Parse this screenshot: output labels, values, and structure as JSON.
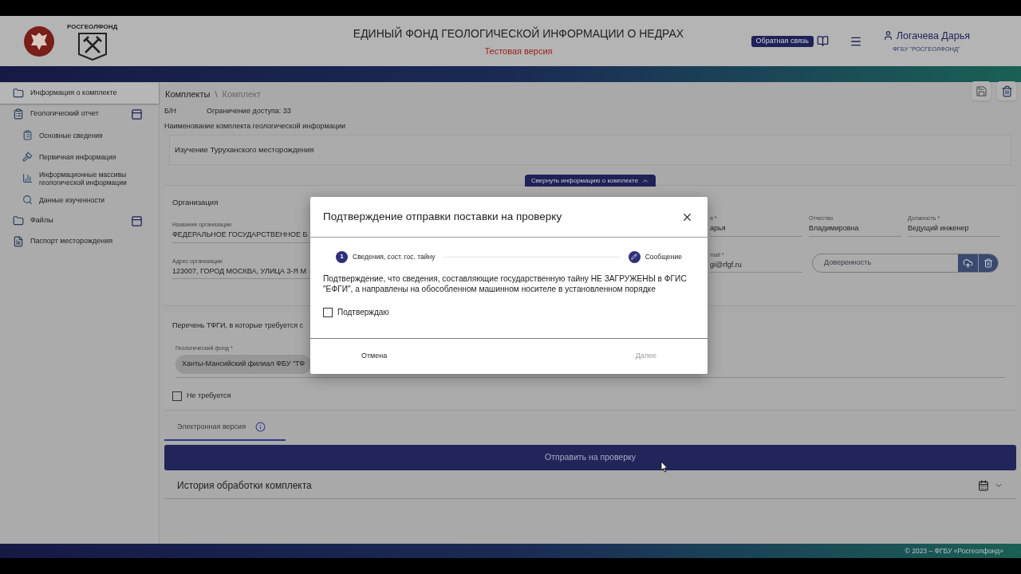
{
  "header": {
    "logo_caption": "РОСГЕОЛФОНД",
    "title": "ЕДИНЫЙ ФОНД ГЕОЛОГИЧЕСКОЙ ИНФОРМАЦИИ О НЕДРАХ",
    "subtitle": "Тестовая версия",
    "feedback_button": "Обратная связь",
    "user_name": "Логачева Дарья",
    "user_org": "ФГБУ \"РОСГЕОЛФОНД\""
  },
  "sidebar": {
    "items": [
      {
        "label": "Информация о комплекте",
        "selected": true
      },
      {
        "label": "Геологический отчет",
        "selected": false,
        "children": [
          {
            "label": "Основные сведения"
          },
          {
            "label": "Первичная информация"
          },
          {
            "label": "Информационные массивы геологической информации"
          },
          {
            "label": "Данные изученности"
          }
        ]
      },
      {
        "label": "Файлы",
        "selected": false
      },
      {
        "label": "Паспорт месторождения",
        "selected": false
      }
    ]
  },
  "breadcrumbs": [
    {
      "label": "Комплекты",
      "current": false
    },
    {
      "label": "Комплект",
      "current": true
    }
  ],
  "breadcrumb_separator": "\\",
  "set_info": {
    "number": "Б/Н",
    "access": "Ограничение доступа: 33",
    "name_label": "Наименование комплекта геологической информации",
    "name_value": "Изучение Туруханского месторождения",
    "collapse_button": "Свернуть информацию о комплекте"
  },
  "organization": {
    "title": "Организация",
    "left_fields": [
      {
        "label": "Название организации",
        "value": "ФЕДЕРАЛЬНОЕ ГОСУДАРСТВЕННОЕ Б"
      },
      {
        "label": "Адрес организации",
        "value": "123007, ГОРОД МОСКВА, УЛИЦА 3-Я М"
      }
    ],
    "right_rows": [
      [
        {
          "kind": "text",
          "label": "я *",
          "value": "арья"
        },
        {
          "kind": "text",
          "label": "Отчество",
          "value": "Владимировна"
        },
        {
          "kind": "text",
          "label": "Должность *",
          "value": "Ведущий инженер"
        }
      ],
      [
        {
          "kind": "text",
          "label": "mail *",
          "value": "gi@rfgf.ru"
        },
        {
          "kind": "file",
          "placeholder": "Доверенность"
        }
      ]
    ]
  },
  "tfgi": {
    "title": "Перечень ТФГИ, в которые требуется с",
    "fund_label": "Геологический фонд *",
    "fund_chip": "Ханты-Мансийский филиал ФБУ \"ТФ",
    "not_required": {
      "label": "Не требуется",
      "checked": false
    }
  },
  "tabs": [
    {
      "label": "Электронная версия",
      "selected": true
    }
  ],
  "submit_button": "Отправить на проверку",
  "history": {
    "title": "История обработки комплекта",
    "expanded": false
  },
  "footer": "© 2023 – ФГБУ «Росгеолфонд»",
  "dialog": {
    "title": "Подтверждение отправки поставки на проверку",
    "steps": [
      {
        "kind": "number",
        "marker": "1",
        "label": "Сведения, сост. гос. тайну"
      },
      {
        "kind": "edit",
        "label": "Сообщение"
      }
    ],
    "message": "Подтверждение, что сведения, составляющие государственную тайну НЕ ЗАГРУЖЕНЫ в ФГИС \"ЕФГИ\", а направлены на обособленном машинном носителе в установленном порядке",
    "confirm": {
      "label": "Подтверждаю",
      "checked": false
    },
    "buttons": [
      {
        "label": "Отмена",
        "disabled": false
      },
      {
        "label": "Далее",
        "disabled": true
      }
    ]
  }
}
